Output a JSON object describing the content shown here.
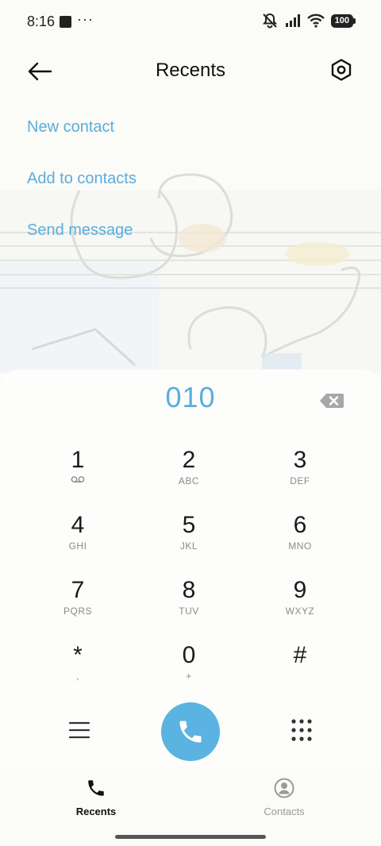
{
  "status_bar": {
    "time": "8:16",
    "more": "···",
    "battery": "100"
  },
  "header": {
    "title": "Recents"
  },
  "actions": [
    {
      "label": "New contact"
    },
    {
      "label": "Add to contacts"
    },
    {
      "label": "Send message"
    }
  ],
  "dialer": {
    "input_value": "010",
    "keys": [
      {
        "digit": "1",
        "sub": ""
      },
      {
        "digit": "2",
        "sub": "ABC"
      },
      {
        "digit": "3",
        "sub": "DEF"
      },
      {
        "digit": "4",
        "sub": "GHI"
      },
      {
        "digit": "5",
        "sub": "JKL"
      },
      {
        "digit": "6",
        "sub": "MNO"
      },
      {
        "digit": "7",
        "sub": "PQRS"
      },
      {
        "digit": "8",
        "sub": "TUV"
      },
      {
        "digit": "9",
        "sub": "WXYZ"
      },
      {
        "digit": "*",
        "sub": ","
      },
      {
        "digit": "0",
        "sub": "+"
      },
      {
        "digit": "#",
        "sub": ""
      }
    ]
  },
  "tabs": [
    {
      "label": "Recents",
      "icon": "phone-icon",
      "active": true
    },
    {
      "label": "Contacts",
      "icon": "contact-icon",
      "active": false
    }
  ],
  "colors": {
    "accent": "#5aaedc",
    "call_button": "#5ab3e0",
    "background": "#fbfbf8"
  }
}
